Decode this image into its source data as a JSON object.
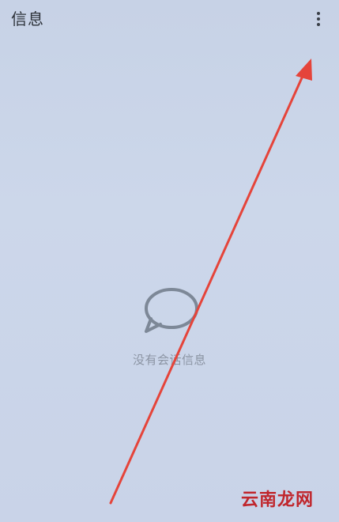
{
  "app": {
    "title": "信息"
  },
  "toolbar": {
    "more_icon": "more-vert-icon"
  },
  "empty_state": {
    "icon": "chat-bubble-icon",
    "message": "没有会话信息"
  },
  "annotation": {
    "arrow_color": "#e5443a"
  },
  "watermark": {
    "text": "云南龙网",
    "color": "#c0262c"
  }
}
